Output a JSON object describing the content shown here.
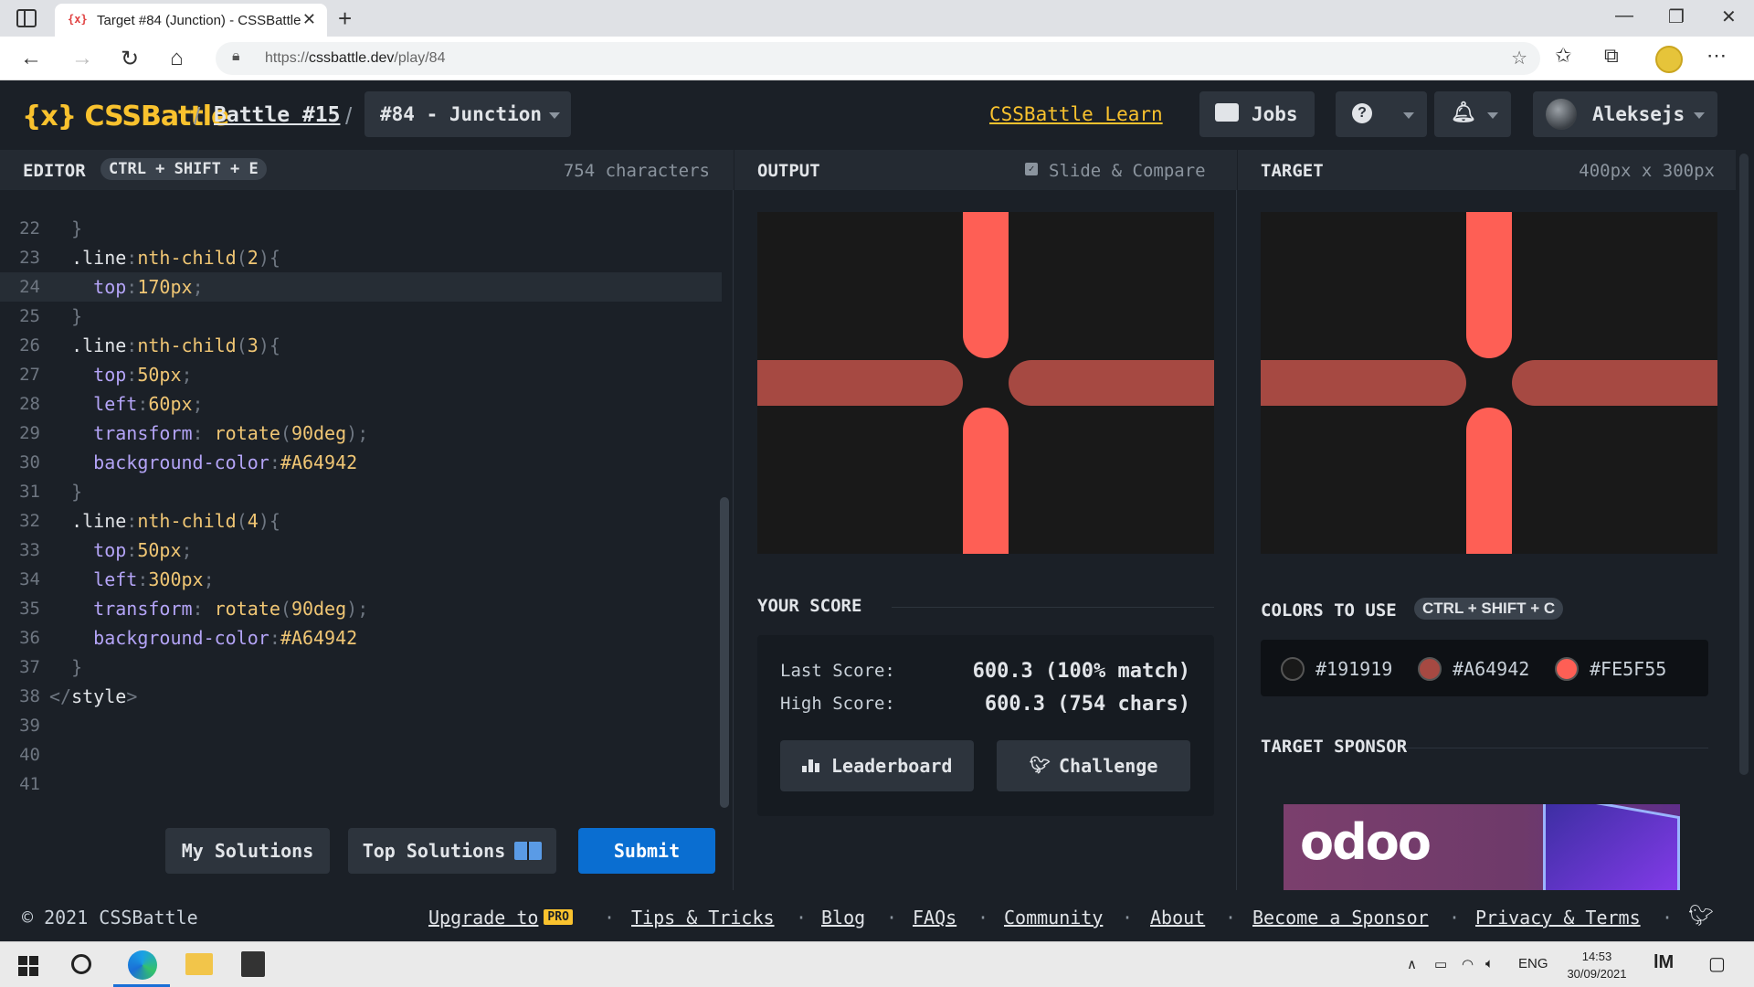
{
  "browser": {
    "tab_title": "Target #84 (Junction) - CSSBattle",
    "tab_favicon": "{x}",
    "url_scheme": "https://",
    "url_host": "cssbattle.dev",
    "url_path": "/play/84"
  },
  "header": {
    "logo": "{x} CSSBattle",
    "battle": "Battle #15",
    "target_select": "#84 - Junction",
    "learn": "CSSBattle Learn",
    "jobs": "Jobs",
    "user": "Aleksejs"
  },
  "editor": {
    "title": "EDITOR",
    "shortcut": "CTRL + SHIFT + E",
    "chars": "754 characters",
    "lines": [
      {
        "n": "22",
        "code": [
          [
            "pun",
            "  }"
          ]
        ]
      },
      {
        "n": "23",
        "code": [
          [
            "sel",
            "  .line"
          ],
          [
            "pun",
            ":"
          ],
          [
            "pse",
            "nth-child"
          ],
          [
            "pun",
            "("
          ],
          [
            "num",
            "2"
          ],
          [
            "pun",
            "){"
          ]
        ]
      },
      {
        "n": "24",
        "code": [
          [
            "prop",
            "    top"
          ],
          [
            "pun",
            ":"
          ],
          [
            "num",
            "170px"
          ],
          [
            "pun",
            ";"
          ]
        ],
        "hl": true
      },
      {
        "n": "25",
        "code": [
          [
            "pun",
            "  }"
          ]
        ]
      },
      {
        "n": "26",
        "code": [
          [
            "sel",
            "  .line"
          ],
          [
            "pun",
            ":"
          ],
          [
            "pse",
            "nth-child"
          ],
          [
            "pun",
            "("
          ],
          [
            "num",
            "3"
          ],
          [
            "pun",
            "){"
          ]
        ]
      },
      {
        "n": "27",
        "code": [
          [
            "prop",
            "    top"
          ],
          [
            "pun",
            ":"
          ],
          [
            "num",
            "50px"
          ],
          [
            "pun",
            ";"
          ]
        ]
      },
      {
        "n": "28",
        "code": [
          [
            "prop",
            "    left"
          ],
          [
            "pun",
            ":"
          ],
          [
            "num",
            "60px"
          ],
          [
            "pun",
            ";"
          ]
        ]
      },
      {
        "n": "29",
        "code": [
          [
            "prop",
            "    transform"
          ],
          [
            "pun",
            ": "
          ],
          [
            "fn",
            "rotate"
          ],
          [
            "pun",
            "("
          ],
          [
            "num",
            "90deg"
          ],
          [
            "pun",
            ");"
          ]
        ]
      },
      {
        "n": "30",
        "code": [
          [
            "prop",
            "    background-color"
          ],
          [
            "pun",
            ":"
          ],
          [
            "num",
            "#A64942"
          ]
        ]
      },
      {
        "n": "31",
        "code": [
          [
            "pun",
            "  }"
          ]
        ]
      },
      {
        "n": "32",
        "code": [
          [
            "sel",
            "  .line"
          ],
          [
            "pun",
            ":"
          ],
          [
            "pse",
            "nth-child"
          ],
          [
            "pun",
            "("
          ],
          [
            "num",
            "4"
          ],
          [
            "pun",
            "){"
          ]
        ]
      },
      {
        "n": "33",
        "code": [
          [
            "prop",
            "    top"
          ],
          [
            "pun",
            ":"
          ],
          [
            "num",
            "50px"
          ],
          [
            "pun",
            ";"
          ]
        ]
      },
      {
        "n": "34",
        "code": [
          [
            "prop",
            "    left"
          ],
          [
            "pun",
            ":"
          ],
          [
            "num",
            "300px"
          ],
          [
            "pun",
            ";"
          ]
        ]
      },
      {
        "n": "35",
        "code": [
          [
            "prop",
            "    transform"
          ],
          [
            "pun",
            ": "
          ],
          [
            "fn",
            "rotate"
          ],
          [
            "pun",
            "("
          ],
          [
            "num",
            "90deg"
          ],
          [
            "pun",
            ");"
          ]
        ]
      },
      {
        "n": "36",
        "code": [
          [
            "prop",
            "    background-color"
          ],
          [
            "pun",
            ":"
          ],
          [
            "num",
            "#A64942"
          ]
        ]
      },
      {
        "n": "37",
        "code": [
          [
            "pun",
            "  }"
          ]
        ]
      },
      {
        "n": "38",
        "code": [
          [
            "pun",
            "</"
          ],
          [
            "tag",
            "style"
          ],
          [
            "pun",
            ">"
          ]
        ]
      },
      {
        "n": "39",
        "code": []
      },
      {
        "n": "40",
        "code": []
      },
      {
        "n": "41",
        "code": []
      }
    ],
    "my_solutions": "My Solutions",
    "top_solutions": "Top Solutions",
    "submit": "Submit"
  },
  "output": {
    "title": "OUTPUT",
    "slide_compare": "Slide & Compare",
    "slide_checked": true,
    "score_title": "YOUR SCORE",
    "last_label": "Last Score:",
    "last_value": "600.3 (100% match)",
    "high_label": "High Score:",
    "high_value": "600.3 (754 chars)",
    "leaderboard": "Leaderboard",
    "challenge": "Challenge"
  },
  "target": {
    "title": "TARGET",
    "size": "400px x 300px",
    "colors_title": "COLORS TO USE",
    "colors_shortcut": "CTRL + SHIFT + C",
    "colors": [
      "#191919",
      "#A64942",
      "#FE5F55"
    ],
    "sponsor_title": "TARGET SPONSOR",
    "sponsor_name": "odoo"
  },
  "footer": {
    "copyright": "© 2021 CSSBattle",
    "upgrade": "Upgrade to",
    "pro": "PRO",
    "links": [
      "Tips & Tricks",
      "Blog",
      "FAQs",
      "Community",
      "About",
      "Become a Sponsor",
      "Privacy & Terms"
    ]
  },
  "taskbar": {
    "lang": "ENG",
    "time": "14:53",
    "date": "30/09/2021"
  }
}
